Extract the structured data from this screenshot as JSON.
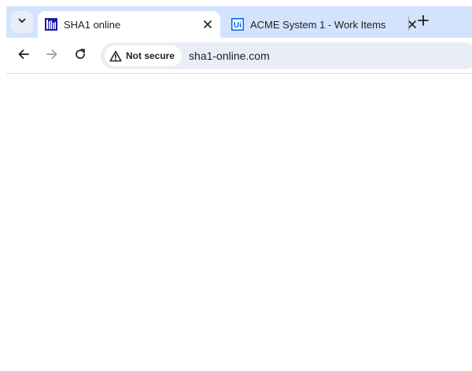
{
  "tabs": [
    {
      "title": "SHA1 online",
      "favicon": "sha1-online-favicon",
      "active": true,
      "close": "close-icon"
    },
    {
      "title": "ACME System 1 - Work Items",
      "favicon": "uipath-favicon",
      "favicon_text": "Ui",
      "active": false,
      "close": "close-icon"
    }
  ],
  "tabstrip": {
    "tab_search_icon": "chevron-down-icon",
    "new_tab_icon": "plus-icon"
  },
  "toolbar": {
    "back_icon": "back-arrow-icon",
    "forward_icon": "forward-arrow-icon",
    "reload_icon": "reload-icon"
  },
  "omnibox": {
    "security_icon": "warning-triangle-icon",
    "security_label": "Not secure",
    "url": "sha1-online.com"
  },
  "colors": {
    "tabstrip_bg": "#d3e3fd",
    "omnibox_bg": "#e9eef6",
    "uipath_blue": "#0067df",
    "text": "#1f1f1f"
  }
}
